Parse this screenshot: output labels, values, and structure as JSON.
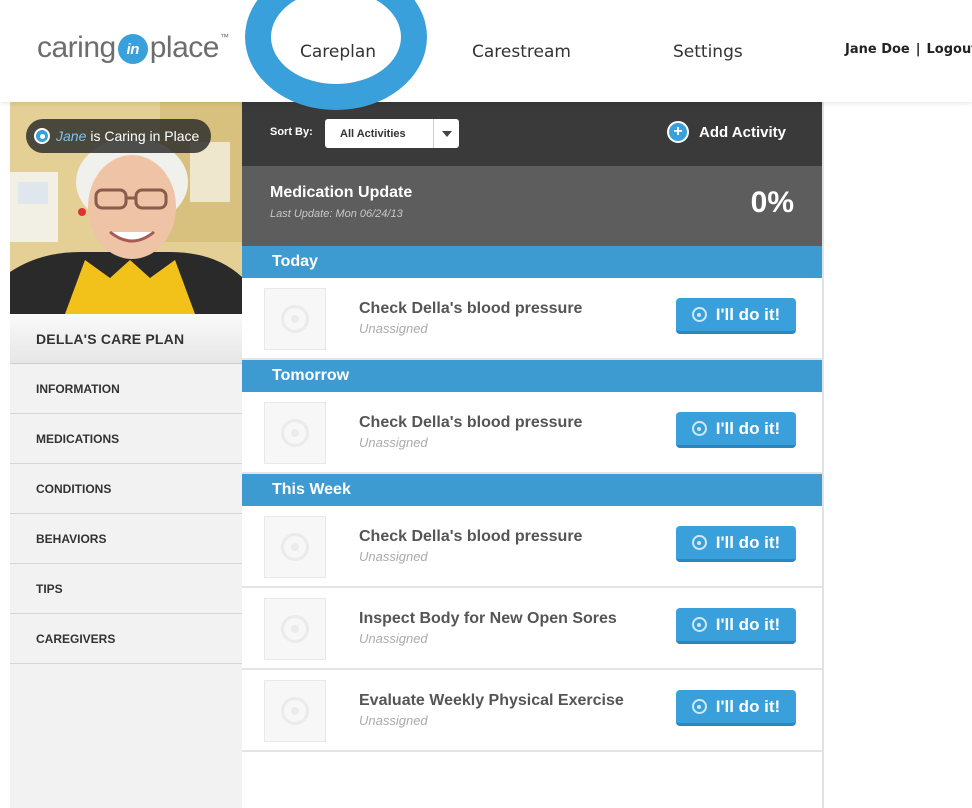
{
  "header": {
    "logo": {
      "part1": "caring",
      "part2": "in",
      "part3": "place",
      "tm": "™"
    },
    "nav": [
      {
        "label": "Careplan",
        "active": true
      },
      {
        "label": "Carestream",
        "active": false
      },
      {
        "label": "Settings",
        "active": false
      }
    ],
    "user_name": "Jane Doe",
    "separator": "|",
    "logout_label": "Logout"
  },
  "profile": {
    "badge_name": "Jane",
    "badge_text": "is Caring in Place",
    "care_plan_title": "DELLA'S CARE PLAN"
  },
  "sidebar": {
    "items": [
      {
        "label": "INFORMATION"
      },
      {
        "label": "MEDICATIONS"
      },
      {
        "label": "CONDITIONS"
      },
      {
        "label": "BEHAVIORS"
      },
      {
        "label": "TIPS"
      },
      {
        "label": "CAREGIVERS"
      }
    ]
  },
  "toolbar": {
    "sort_label": "Sort By:",
    "sort_value": "All Activities",
    "add_label": "Add Activity"
  },
  "med_update": {
    "title": "Medication Update",
    "subtitle": "Last Update: Mon 06/24/13",
    "percent": "0%"
  },
  "sections": [
    {
      "title": "Today",
      "tasks": [
        {
          "title": "Check Della's blood pressure",
          "assignee": "Unassigned",
          "button": "I'll do it!"
        }
      ]
    },
    {
      "title": "Tomorrow",
      "tasks": [
        {
          "title": "Check Della's blood pressure",
          "assignee": "Unassigned",
          "button": "I'll do it!"
        }
      ]
    },
    {
      "title": "This Week",
      "tasks": [
        {
          "title": "Check Della's blood pressure",
          "assignee": "Unassigned",
          "button": "I'll do it!"
        },
        {
          "title": "Inspect Body for New Open Sores",
          "assignee": "Unassigned",
          "button": "I'll do it!"
        },
        {
          "title": "Evaluate Weekly Physical Exercise",
          "assignee": "Unassigned",
          "button": "I'll do it!"
        }
      ]
    }
  ],
  "colors": {
    "accent_blue": "#3aa0dc",
    "section_blue": "#3e9bd2",
    "toolbar_dark": "#3a3a3a",
    "med_gray": "#5d5d5d"
  }
}
